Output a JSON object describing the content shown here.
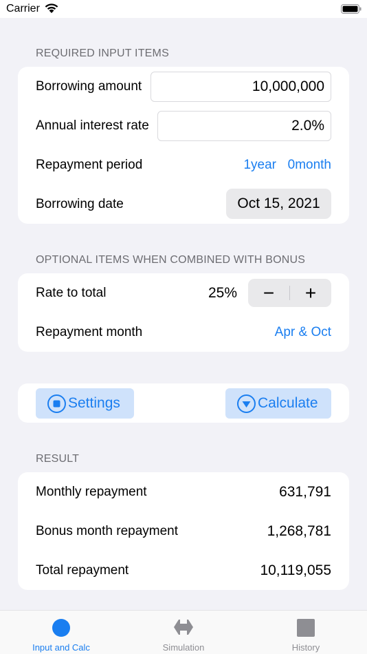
{
  "status_bar": {
    "carrier": "Carrier"
  },
  "required": {
    "header": "REQUIRED INPUT ITEMS",
    "borrowing_amount_label": "Borrowing amount",
    "borrowing_amount_value": "10,000,000",
    "interest_rate_label": "Annual interest rate",
    "interest_rate_value": "2.0%",
    "repayment_period_label": "Repayment period",
    "period_years": "1year",
    "period_months": "0month",
    "borrowing_date_label": "Borrowing date",
    "borrowing_date_value": "Oct 15, 2021"
  },
  "optional": {
    "header": "OPTIONAL ITEMS WHEN COMBINED WITH BONUS",
    "rate_label": "Rate to total",
    "rate_value": "25%",
    "minus": "−",
    "plus": "+",
    "repayment_month_label": "Repayment month",
    "repayment_month_value": "Apr & Oct"
  },
  "actions": {
    "settings_label": "Settings",
    "calculate_label": "Calculate"
  },
  "result": {
    "header": "RESULT",
    "monthly_label": "Monthly repayment",
    "monthly_value": "631,791",
    "bonus_label": "Bonus month repayment",
    "bonus_value": "1,268,781",
    "total_label": "Total repayment",
    "total_value": "10,119,055"
  },
  "tabs": [
    {
      "label": "Input and Calc",
      "active": true,
      "color": "#1a7ef0"
    },
    {
      "label": "Simulation",
      "active": false,
      "color": "#8e8e93"
    },
    {
      "label": "History",
      "active": false,
      "color": "#8e8e93"
    }
  ],
  "colors": {
    "accent": "#1a7ef0",
    "background": "#f2f2f7",
    "button_fill": "#cfe2fb"
  }
}
